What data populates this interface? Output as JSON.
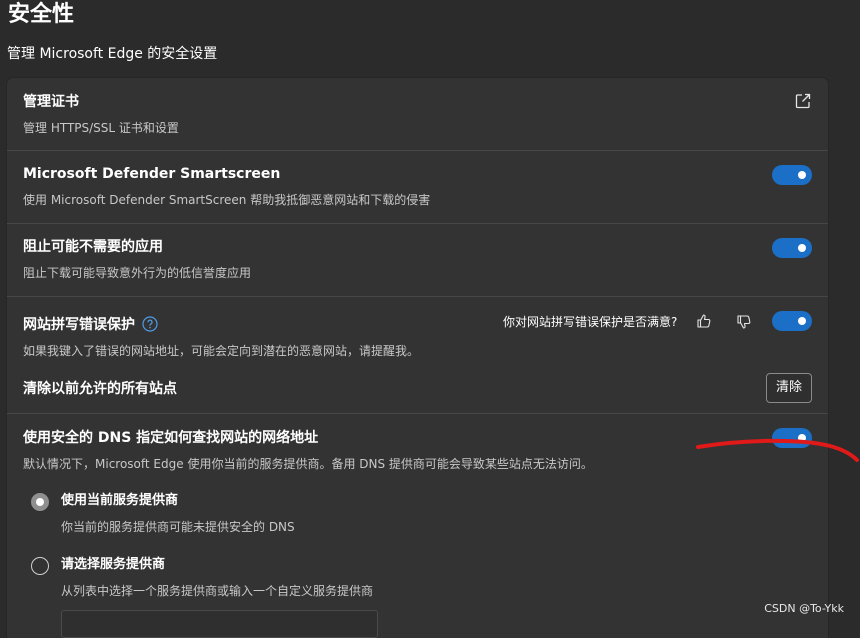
{
  "page": {
    "title": "安全性",
    "subtitle": "管理 Microsoft Edge 的安全设置"
  },
  "certificates": {
    "title": "管理证书",
    "desc": "管理 HTTPS/SSL 证书和设置",
    "icon": "external-link-icon"
  },
  "smartscreen": {
    "title": "Microsoft Defender Smartscreen",
    "desc": "使用 Microsoft Defender SmartScreen 帮助我抵御恶意网站和下载的侵害",
    "enabled": true
  },
  "pua": {
    "title": "阻止可能不需要的应用",
    "desc": "阻止下载可能导致意外行为的低信誉度应用",
    "enabled": true
  },
  "typo": {
    "title": "网站拼写错误保护",
    "desc": "如果我键入了错误的网站地址，可能会定向到潜在的恶意网站，请提醒我。",
    "feedback_question": "你对网站拼写错误保护是否满意?",
    "enabled": true
  },
  "clear_sites": {
    "title": "清除以前允许的所有站点",
    "button_label": "清除"
  },
  "dns": {
    "title": "使用安全的 DNS 指定如何查找网站的网络地址",
    "desc": "默认情况下，Microsoft Edge 使用你当前的服务提供商。备用 DNS 提供商可能会导致某些站点无法访问。",
    "enabled": true,
    "options": [
      {
        "title": "使用当前服务提供商",
        "desc": "你当前的服务提供商可能未提供安全的 DNS",
        "selected": true
      },
      {
        "title": "请选择服务提供商",
        "desc": "从列表中选择一个服务提供商或输入一个自定义服务提供商",
        "selected": false
      }
    ]
  },
  "watermark": "CSDN @To-Ykk",
  "colors": {
    "background": "#2b2b2b",
    "card": "#333333",
    "toggle_on": "#1b6fc6",
    "annotation": "#e01919"
  }
}
